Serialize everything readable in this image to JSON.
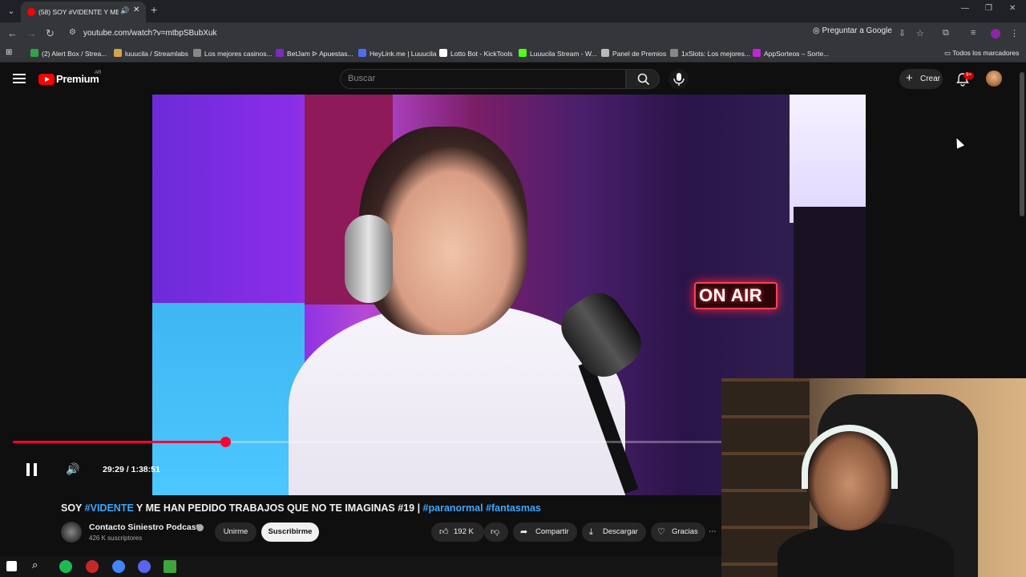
{
  "browser": {
    "tab_title": "(58) SOY #VIDENTE Y ME H",
    "url": "youtube.com/watch?v=mtbpSBubXuk",
    "ask_google": "Preguntar a Google",
    "all_bookmarks": "Todos los marcadores",
    "bookmarks": [
      {
        "label": "(2) Alert Box / Strea...",
        "color": "#31a24c"
      },
      {
        "label": "luuucila / Streamlabs",
        "color": "#d1a54c"
      },
      {
        "label": "Los mejores casinos...",
        "color": "#888888"
      },
      {
        "label": "BetJam ᐅ Apuestas...",
        "color": "#7b2cbf"
      },
      {
        "label": "HeyLink.me | Luuucila",
        "color": "#4c6ef5"
      },
      {
        "label": "Lotto Bot - KickTools",
        "color": "#ffffff"
      },
      {
        "label": "Luuucila Stream - W...",
        "color": "#53fc18"
      },
      {
        "label": "Panel de Premios",
        "color": "#bbbbbb"
      },
      {
        "label": "1xSlots: Los mejores...",
        "color": "#888888"
      },
      {
        "label": "AppSorteos – Sorte...",
        "color": "#c026d3"
      }
    ]
  },
  "youtube": {
    "brand": "Premium",
    "region": "AR",
    "search_placeholder": "Buscar",
    "create_label": "Crear",
    "notification_count": "9+"
  },
  "video": {
    "overlay_sign": "ON AIR",
    "time": "29:29 / 1:38:51",
    "progress": 0.3,
    "title_parts": {
      "p1": "SOY ",
      "t1": "#VIDENTE",
      "p2": " Y ME HAN PEDIDO TRABAJOS QUE NO TE IMAGINAS #19 | ",
      "t2": "#paranormal",
      "p3": " ",
      "t3": "#fantasmas"
    },
    "channel": "Contacto Siniestro Podcast",
    "subscribers": "426 K suscriptores",
    "join_label": "Unirme",
    "subscribe_label": "Suscribirme",
    "likes": "192 K",
    "share_label": "Compartir",
    "download_label": "Descargar",
    "thanks_label": "Gracias"
  }
}
